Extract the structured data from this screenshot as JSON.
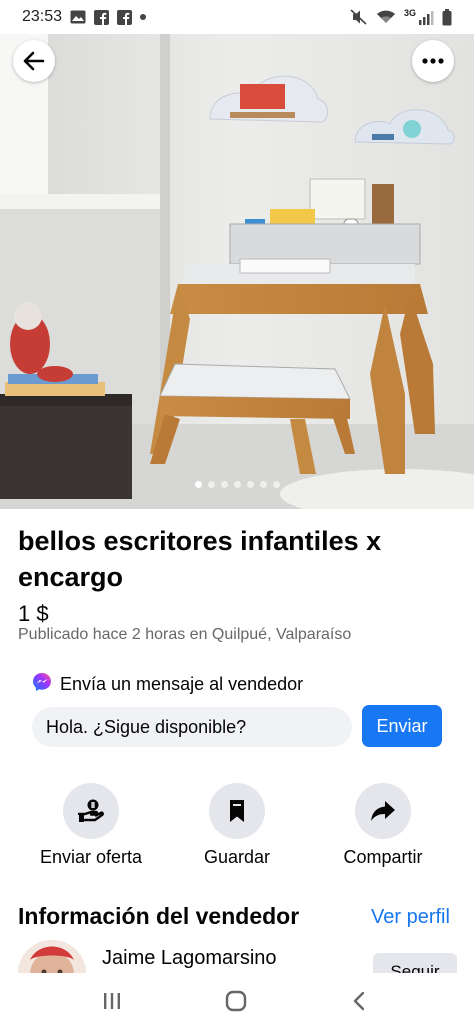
{
  "status_bar": {
    "time": "23:53",
    "left_icons": [
      "gallery-icon",
      "facebook-icon",
      "facebook-icon",
      "dot-icon"
    ],
    "right_icons": [
      "mute-icon",
      "wifi-icon",
      "signal-icon",
      "battery-icon"
    ],
    "network": "3G"
  },
  "listing": {
    "title": "bellos escritores infantiles x encargo",
    "price": "1 $",
    "posted": "Publicado hace 2 horas en Quilpué, Valparaíso",
    "image_count": 7,
    "active_image": 1
  },
  "message": {
    "heading": "Envía un mensaje al vendedor",
    "input_value": "Hola. ¿Sigue disponible?",
    "send_label": "Enviar"
  },
  "actions": [
    {
      "label": "Enviar oferta",
      "icon": "make-offer-icon"
    },
    {
      "label": "Guardar",
      "icon": "bookmark-icon"
    },
    {
      "label": "Compartir",
      "icon": "share-icon"
    }
  ],
  "seller": {
    "section_title": "Información del vendedor",
    "profile_link": "Ver perfil",
    "name": "Jaime Lagomarsino",
    "follow_label": "Seguir"
  },
  "colors": {
    "accent": "#1877f2",
    "secondary_text": "#65676b",
    "chip_bg": "#e4e6eb"
  }
}
